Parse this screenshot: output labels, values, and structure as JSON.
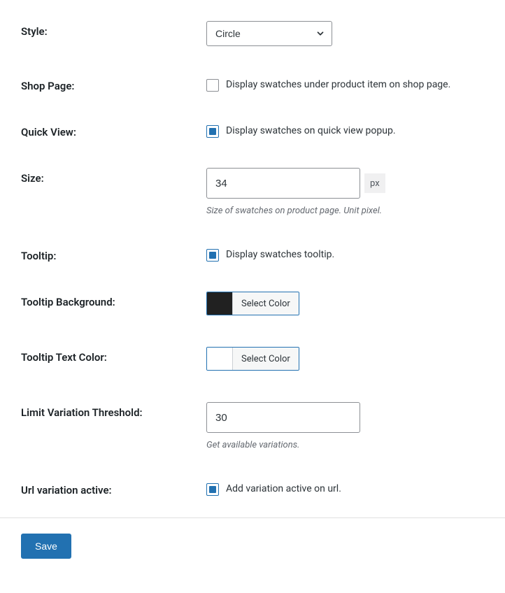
{
  "style": {
    "label": "Style:",
    "value": "Circle"
  },
  "shop_page": {
    "label": "Shop Page:",
    "checked": false,
    "text": "Display swatches under product item on shop page."
  },
  "quick_view": {
    "label": "Quick View:",
    "checked": true,
    "text": "Display swatches on quick view popup."
  },
  "size": {
    "label": "Size:",
    "value": "34",
    "unit": "px",
    "help": "Size of swatches on product page. Unit pixel."
  },
  "tooltip": {
    "label": "Tooltip:",
    "checked": true,
    "text": "Display swatches tooltip."
  },
  "tooltip_bg": {
    "label": "Tooltip Background:",
    "color": "#212121",
    "button": "Select Color"
  },
  "tooltip_text": {
    "label": "Tooltip Text Color:",
    "color": "#ffffff",
    "button": "Select Color"
  },
  "limit": {
    "label": "Limit Variation Threshold:",
    "value": "30",
    "help": "Get available variations."
  },
  "url_active": {
    "label": "Url variation active:",
    "checked": true,
    "text": "Add variation active on url."
  },
  "footer": {
    "save": "Save"
  }
}
